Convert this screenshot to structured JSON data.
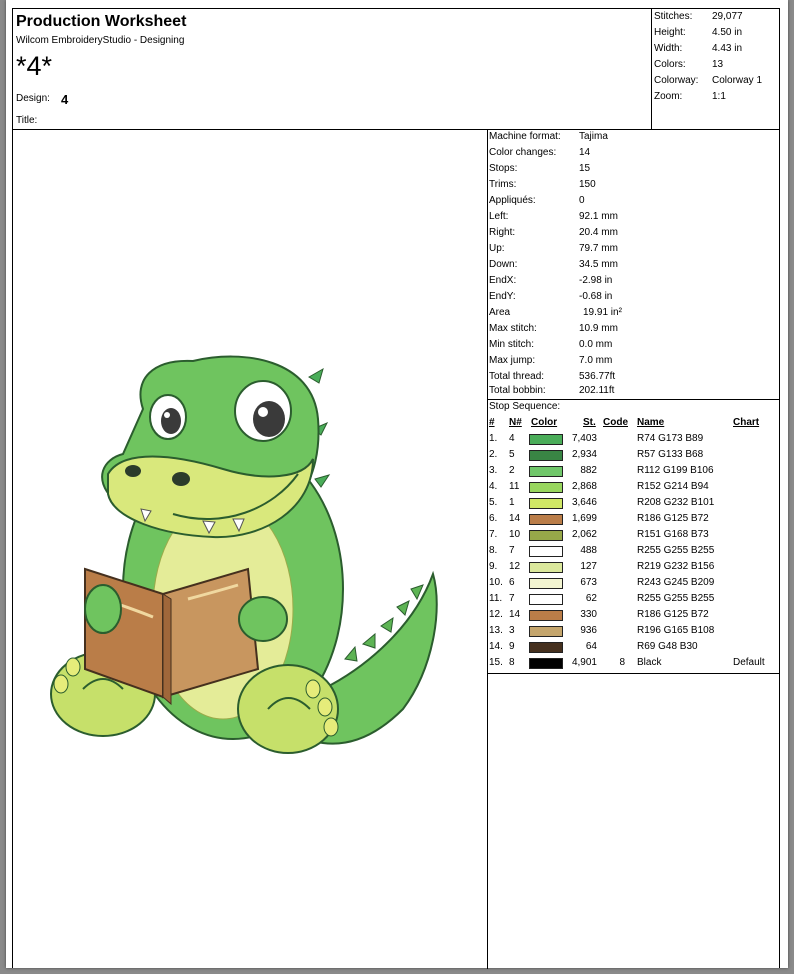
{
  "header": {
    "title": "Production Worksheet",
    "subtitle": "Wilcom EmbroideryStudio - Designing",
    "design_big": "*4*",
    "design_label": "Design:",
    "design_value": "4",
    "title_label": "Title:"
  },
  "summary": [
    {
      "label": "Stitches:",
      "value": "29,077"
    },
    {
      "label": "Height:",
      "value": "4.50 in"
    },
    {
      "label": "Width:",
      "value": "4.43 in"
    },
    {
      "label": "Colors:",
      "value": "13"
    },
    {
      "label": "Colorway:",
      "value": "Colorway 1"
    },
    {
      "label": "Zoom:",
      "value": "1:1"
    }
  ],
  "stats": [
    {
      "label": "Machine format:",
      "value": "Tajima"
    },
    {
      "label": "Color changes:",
      "value": "14"
    },
    {
      "label": "Stops:",
      "value": "15"
    },
    {
      "label": "Trims:",
      "value": "150"
    },
    {
      "label": "Appliqués:",
      "value": "0"
    },
    {
      "label": "Left:",
      "value": "92.1 mm"
    },
    {
      "label": "Right:",
      "value": "20.4 mm"
    },
    {
      "label": "Up:",
      "value": "79.7 mm"
    },
    {
      "label": "Down:",
      "value": "34.5 mm"
    },
    {
      "label": "EndX:",
      "value": "-2.98 in"
    },
    {
      "label": "EndY:",
      "value": "-0.68 in"
    },
    {
      "label": "Area",
      "value": "19.91 in²"
    },
    {
      "label": "Max stitch:",
      "value": "10.9 mm"
    },
    {
      "label": "Min stitch:",
      "value": "0.0 mm"
    },
    {
      "label": "Max jump:",
      "value": "7.0 mm"
    },
    {
      "label": "Total thread:",
      "value": "536.77ft"
    },
    {
      "label": "Total bobbin:",
      "value": "202.11ft"
    }
  ],
  "sequence": {
    "title": "Stop Sequence:",
    "headers": {
      "num": "#",
      "n": "N#",
      "color": "Color",
      "st": "St.",
      "code": "Code",
      "name": "Name",
      "chart": "Chart"
    },
    "rows": [
      {
        "num": "1.",
        "n": "4",
        "color": "#4aad59",
        "st": "7,403",
        "code": "",
        "name": "R74 G173 B89",
        "chart": ""
      },
      {
        "num": "2.",
        "n": "5",
        "color": "#398544",
        "st": "2,934",
        "code": "",
        "name": "R57 G133 B68",
        "chart": ""
      },
      {
        "num": "3.",
        "n": "2",
        "color": "#70c76a",
        "st": "882",
        "code": "",
        "name": "R112 G199 B106",
        "chart": ""
      },
      {
        "num": "4.",
        "n": "11",
        "color": "#98d65e",
        "st": "2,868",
        "code": "",
        "name": "R152 G214 B94",
        "chart": ""
      },
      {
        "num": "5.",
        "n": "1",
        "color": "#d0e865",
        "st": "3,646",
        "code": "",
        "name": "R208 G232 B101",
        "chart": ""
      },
      {
        "num": "6.",
        "n": "14",
        "color": "#ba7d48",
        "st": "1,699",
        "code": "",
        "name": "R186 G125 B72",
        "chart": ""
      },
      {
        "num": "7.",
        "n": "10",
        "color": "#97a849",
        "st": "2,062",
        "code": "",
        "name": "R151 G168 B73",
        "chart": ""
      },
      {
        "num": "8.",
        "n": "7",
        "color": "#ffffff",
        "st": "488",
        "code": "",
        "name": "R255 G255 B255",
        "chart": ""
      },
      {
        "num": "9.",
        "n": "12",
        "color": "#dbe89c",
        "st": "127",
        "code": "",
        "name": "R219 G232 B156",
        "chart": ""
      },
      {
        "num": "10.",
        "n": "6",
        "color": "#f3f5d1",
        "st": "673",
        "code": "",
        "name": "R243 G245 B209",
        "chart": ""
      },
      {
        "num": "11.",
        "n": "7",
        "color": "#ffffff",
        "st": "62",
        "code": "",
        "name": "R255 G255 B255",
        "chart": ""
      },
      {
        "num": "12.",
        "n": "14",
        "color": "#ba7d48",
        "st": "330",
        "code": "",
        "name": "R186 G125 B72",
        "chart": ""
      },
      {
        "num": "13.",
        "n": "3",
        "color": "#c4a56c",
        "st": "936",
        "code": "",
        "name": "R196 G165 B108",
        "chart": ""
      },
      {
        "num": "14.",
        "n": "9",
        "color": "#45301e",
        "st": "64",
        "code": "",
        "name": "R69 G48 B30",
        "chart": ""
      },
      {
        "num": "15.",
        "n": "8",
        "color": "#000000",
        "st": "4,901",
        "code": "8",
        "name": "Black",
        "chart": "Default"
      }
    ]
  }
}
